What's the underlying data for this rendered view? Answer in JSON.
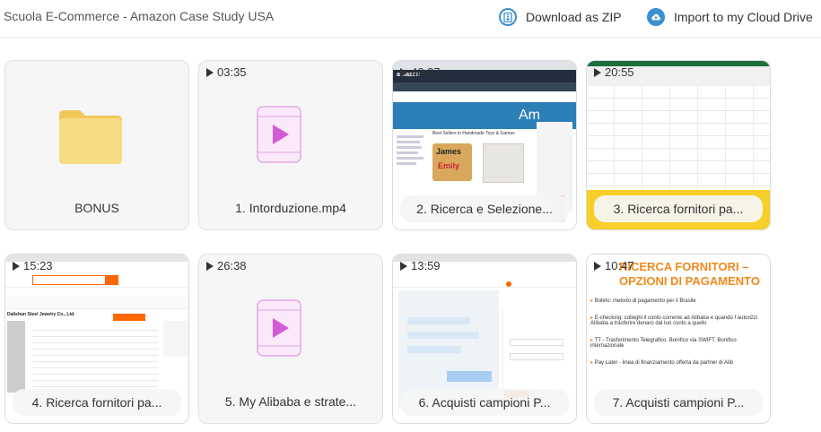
{
  "header": {
    "title": "Scuola E-Commerce - Amazon Case Study USA",
    "download_label": "Download as ZIP",
    "download_icon": "zip-download-icon",
    "import_label": "Import to my Cloud Drive",
    "import_icon": "cloud-upload-icon",
    "accent": "#3b8fd0"
  },
  "items": [
    {
      "name": "BONUS",
      "type": "folder",
      "duration": ""
    },
    {
      "name": "1. Intorduzione.mp4",
      "type": "video",
      "duration": "03:35"
    },
    {
      "name": "2. Ricerca e Selezione...",
      "type": "video",
      "duration": "40:27"
    },
    {
      "name": "3. Ricerca fornitori pa...",
      "type": "video",
      "duration": "20:55"
    },
    {
      "name": "4. Ricerca fornitori pa...",
      "type": "video",
      "duration": "15:23"
    },
    {
      "name": "5. My Alibaba e strate...",
      "type": "video",
      "duration": "26:38"
    },
    {
      "name": "6. Acquisti campioni P...",
      "type": "video",
      "duration": "13:59"
    },
    {
      "name": "7. Acquisti campioni P...",
      "type": "video",
      "duration": "10:47"
    }
  ],
  "thumbs": {
    "amazon_word": "amazon",
    "handmade_heading": "Best Sellers in Handmade Toys & Games",
    "doll_text": [
      "James",
      "Emily"
    ],
    "slide_title_line1": "RICERCA FORNITORI –",
    "slide_title_line2": "OPZIONI DI PAGAMENTO",
    "slide_bullets": [
      "Boleto: metodo di pagamento per il Brasile",
      "E-checking: colleghi il conto corrente ad Alibaba e quando f autorizzi Alibaba a trasferire denaro dal tuo conto a quello",
      "TT - Trasferimento Telegrafico. Bonifico via SWIFT. Bonifico internazionale",
      "Pay Later - linea di finanziamento offerta da partner di Alib"
    ],
    "supplier_name": "Dalishun Steel Jewelry Co., Ltd."
  },
  "colors": {
    "folder": "#f5d77a",
    "video_icon": "#d45ad8",
    "slide_orange": "#f08a1c",
    "sheet_yellow": "#f7cf2a"
  }
}
